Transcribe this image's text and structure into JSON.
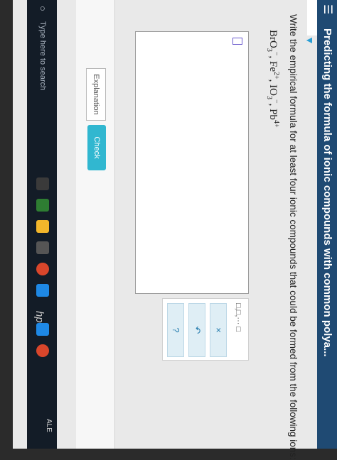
{
  "app": {
    "title": "Predicting the formula of ionic compounds with common polya...",
    "menu_icon": "hamburger-icon",
    "collapse_icon": "chevron-down-icon"
  },
  "question": {
    "prompt": "Write the empirical formula for at least four ionic compounds that could be formed from the following ions:",
    "ions": [
      {
        "base": "BrO",
        "sub": "3",
        "sup": "−"
      },
      {
        "base": "Fe",
        "sub": "",
        "sup": "2+"
      },
      {
        "base": "IO",
        "sub": "3",
        "sup": "−"
      },
      {
        "base": "Pb",
        "sub": "",
        "sup": "4+"
      }
    ]
  },
  "tools": {
    "format_label": "□,□,··· □",
    "clear_label": "×",
    "undo_label": "↶",
    "help_label": "?"
  },
  "bottom": {
    "explanation_label": "Explanation",
    "check_label": "Check"
  },
  "taskbar": {
    "search_placeholder": "Type here to search",
    "tray_text": "ALE"
  },
  "colors": {
    "header": "#1f4a73",
    "accent": "#31b7d0",
    "taskbar": "#131c27"
  }
}
